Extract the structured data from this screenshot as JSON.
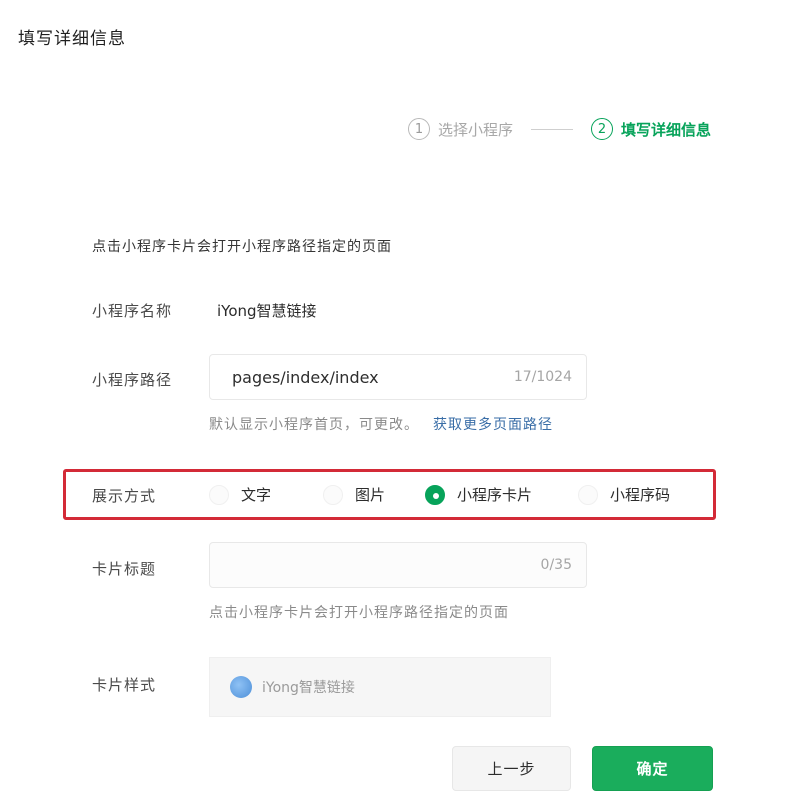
{
  "dialog": {
    "title": "填写详细信息"
  },
  "steps": [
    {
      "num": "1",
      "label": "选择小程序"
    },
    {
      "num": "2",
      "label": "填写详细信息"
    }
  ],
  "form": {
    "top_hint": "点击小程序卡片会打开小程序路径指定的页面",
    "name": {
      "label": "小程序名称",
      "value": "iYong智慧链接"
    },
    "path": {
      "label": "小程序路径",
      "value": "pages/index/index",
      "counter": "17/1024",
      "hint": "默认显示小程序首页，可更改。",
      "hint_link": "获取更多页面路径"
    },
    "display": {
      "label": "展示方式",
      "options": [
        "文字",
        "图片",
        "小程序卡片",
        "小程序码"
      ],
      "selected": "小程序卡片"
    },
    "card_title": {
      "label": "卡片标题",
      "value": "",
      "counter": "0/35",
      "hint": "点击小程序卡片会打开小程序路径指定的页面"
    },
    "card_style": {
      "label": "卡片样式",
      "preview_name": "iYong智慧链接"
    }
  },
  "buttons": {
    "prev": "上一步",
    "ok": "确定"
  },
  "colors": {
    "accent": "#07a35a",
    "highlight": "#d32a37",
    "link": "#3a6ea7"
  }
}
